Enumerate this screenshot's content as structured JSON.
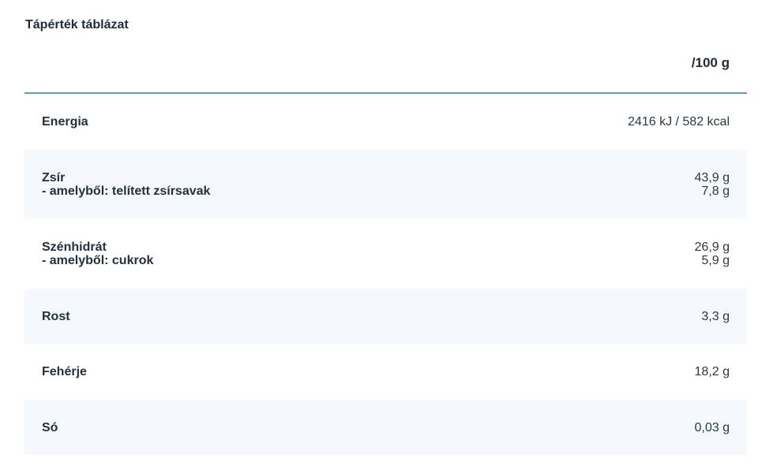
{
  "title": "Tápérték táblázat",
  "table": {
    "unit_header": "/100 g",
    "rows": [
      {
        "label": "Energia",
        "value": "2416 kJ / 582 kcal"
      },
      {
        "label": "Zsír",
        "sub_label": "- amelyből: telített zsírsavak",
        "value": "43,9 g",
        "sub_value": "7,8 g"
      },
      {
        "label": "Szénhidrát",
        "sub_label": "- amelyből: cukrok",
        "value": "26,9 g",
        "sub_value": "5,9 g"
      },
      {
        "label": "Rost",
        "value": "3,3 g"
      },
      {
        "label": "Fehérje",
        "value": "18,2 g"
      },
      {
        "label": "Só",
        "value": "0,03 g"
      }
    ]
  }
}
